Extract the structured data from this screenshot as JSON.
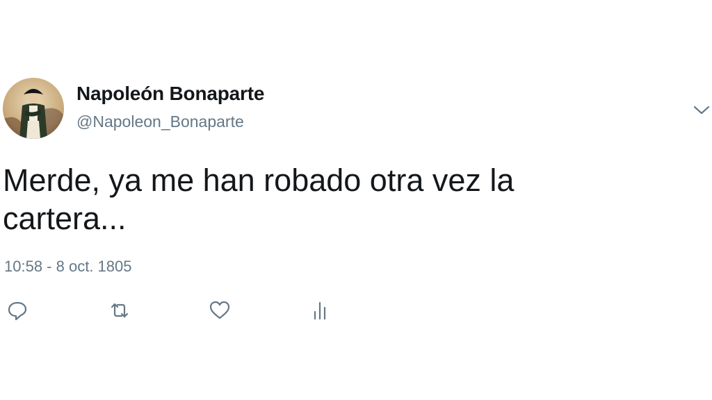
{
  "tweet": {
    "author_name": "Napoleón Bonaparte",
    "author_handle": "@Napoleon_Bonaparte",
    "text_line1": "Merde, ya me han robado otra vez la",
    "text_line2": "cartera...",
    "time": "10:58",
    "separator": " - ",
    "date": "8 oct. 1805"
  },
  "icons": {
    "menu": "chevron-down-icon",
    "reply": "reply-icon",
    "retweet": "retweet-icon",
    "like": "heart-icon",
    "analytics": "analytics-icon"
  },
  "colors": {
    "text": "#14171a",
    "secondary": "#657786",
    "icon": "#657786"
  }
}
